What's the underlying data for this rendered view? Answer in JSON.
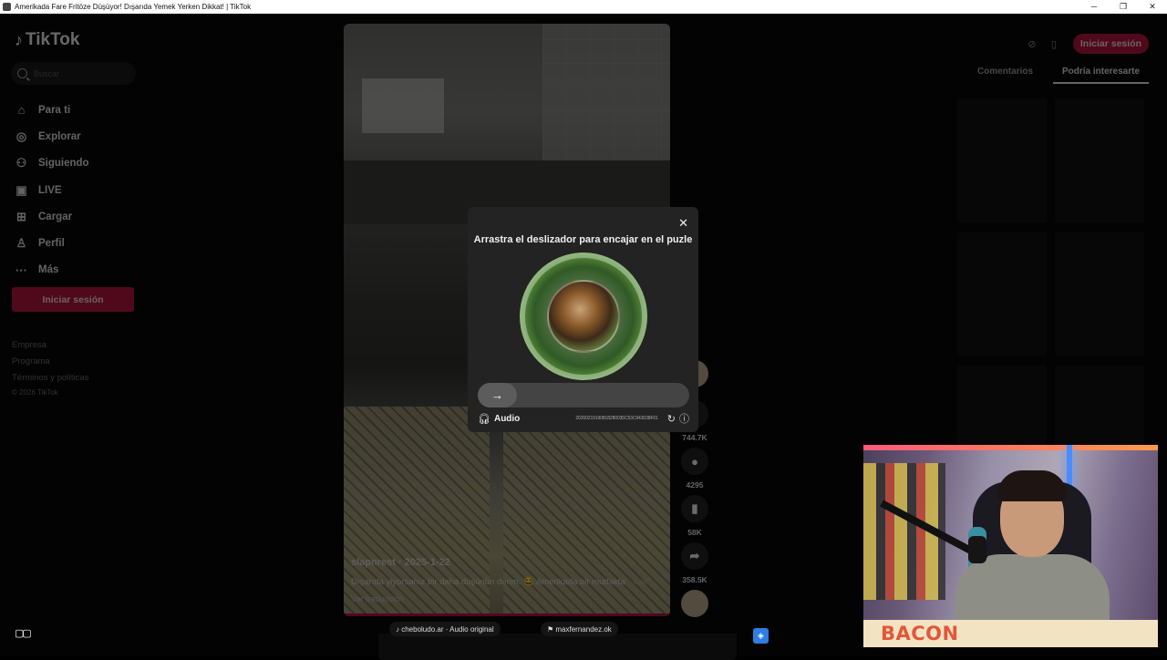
{
  "window": {
    "title": "Amerikada Fare Fritöze Düşüyor! Dışarıda Yemek Yerken Dikkat! | TikTok",
    "controls": [
      "─",
      "❐",
      "✕"
    ]
  },
  "sidebar": {
    "logo": "TikTok",
    "search_placeholder": "Buscar",
    "items": [
      {
        "icon": "home-icon",
        "glyph": "⌂",
        "label": "Para ti"
      },
      {
        "icon": "compass-icon",
        "glyph": "◎",
        "label": "Explorar"
      },
      {
        "icon": "following-icon",
        "glyph": "⚇",
        "label": "Siguiendo"
      },
      {
        "icon": "live-icon",
        "glyph": "▣",
        "label": "LIVE"
      },
      {
        "icon": "upload-icon",
        "glyph": "⊞",
        "label": "Cargar"
      },
      {
        "icon": "profile-icon",
        "glyph": "♙",
        "label": "Perfil"
      },
      {
        "icon": "more-icon",
        "glyph": "···",
        "label": "Más"
      }
    ],
    "login_button": "Iniciar sesión",
    "footer": [
      "Empresa",
      "Programa",
      "Términos y políticas"
    ],
    "copyright": "© 2026 TikTok"
  },
  "video": {
    "username": "slapnrest · 2025-1-22",
    "description": "Dışarıda yiyorsanız bir daha düşünün derim. 😂 Amerikada bir mutfakta",
    "more": "más",
    "translate": "Ver traducción"
  },
  "actions": {
    "likes": "744.7K",
    "comments": "4295",
    "saves": "58K",
    "shares": "358.5K"
  },
  "right_panel": {
    "login_button": "Iniciar sesión",
    "tabs": [
      "Comentarios",
      "Podría interesarte"
    ],
    "active_tab": 1
  },
  "captcha": {
    "title": "Arrastra el deslizador para encajar en el puzle",
    "slider_arrow": "→",
    "audio_label": "Audio",
    "code": "20260219190818280035C53C943038F01",
    "accent_color": "#b0163c"
  },
  "bottom": {
    "sound": "♪ cheboludo.ar · Audio original",
    "mention": "⚑ maxfernandez.ok"
  },
  "webcam": {
    "banner": "BACON"
  }
}
